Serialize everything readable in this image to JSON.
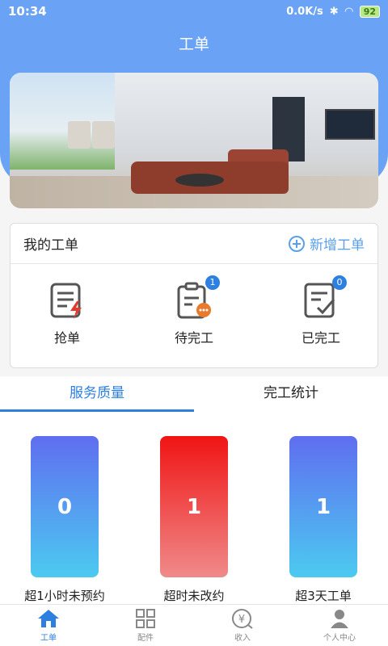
{
  "status": {
    "time": "10:34",
    "net_speed": "0.0K/s",
    "battery": "92"
  },
  "header": {
    "title": "工单"
  },
  "card": {
    "title": "我的工单",
    "add_label": "新增工单",
    "items": [
      {
        "label": "抢单",
        "icon": "grab-order-icon",
        "badge": ""
      },
      {
        "label": "待完工",
        "icon": "pending-icon",
        "badge": "1"
      },
      {
        "label": "已完工",
        "icon": "completed-icon",
        "badge": "0"
      }
    ]
  },
  "tabs": [
    {
      "label": "服务质量",
      "active": true
    },
    {
      "label": "完工统计",
      "active": false
    }
  ],
  "stats": [
    {
      "value": "0",
      "label": "超1小时未预约",
      "color": "blue"
    },
    {
      "value": "1",
      "label": "超时未改约",
      "color": "red"
    },
    {
      "value": "1",
      "label": "超3天工单",
      "color": "blue"
    }
  ],
  "nav": [
    {
      "label": "工单",
      "icon": "home-icon",
      "active": true
    },
    {
      "label": "配件",
      "icon": "grid-icon",
      "active": false
    },
    {
      "label": "收入",
      "icon": "yuan-icon",
      "active": false
    },
    {
      "label": "个人中心",
      "icon": "user-icon",
      "active": false
    }
  ],
  "colors": {
    "primary": "#2d7fe0",
    "header": "#6aa3f5",
    "alert": "#f01414"
  }
}
